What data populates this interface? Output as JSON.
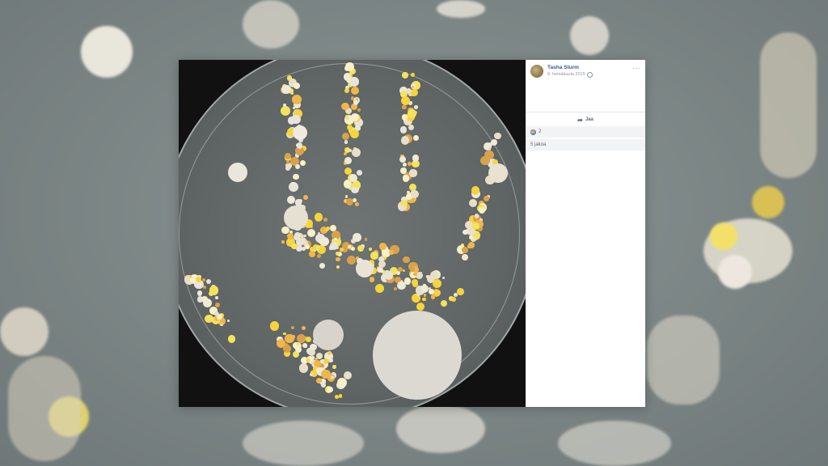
{
  "post": {
    "author": "Tasha Sturm",
    "date": "9. heinäkuuta 2015",
    "more_label": "···",
    "share_label": "Jaa",
    "reaction_count": "2",
    "shares_label": "5 jakoa"
  },
  "icons": {
    "avatar": "profile-avatar",
    "globe": "globe-icon",
    "share": "share-arrow-icon",
    "like": "like-thumb-icon"
  },
  "colors": {
    "link": "#385898",
    "like": "#3b7cf6",
    "panel_bg": "#ffffff",
    "photo_bg": "#111111"
  }
}
